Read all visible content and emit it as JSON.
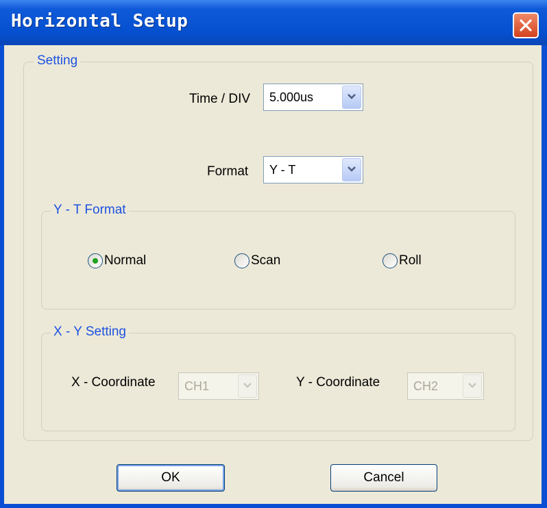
{
  "window": {
    "title": "Horizontal Setup"
  },
  "setting_group": {
    "legend": "Setting",
    "time_div_label": "Time / DIV",
    "time_div_value": "5.000us",
    "format_label": "Format",
    "format_value": "Y - T"
  },
  "yt_group": {
    "legend": "Y - T Format",
    "options": [
      {
        "label": "Normal",
        "selected": true
      },
      {
        "label": "Scan",
        "selected": false
      },
      {
        "label": "Roll",
        "selected": false
      }
    ]
  },
  "xy_group": {
    "legend": "X - Y Setting",
    "x_label": "X - Coordinate",
    "x_value": "CH1",
    "y_label": "Y - Coordinate",
    "y_value": "CH2",
    "enabled": false
  },
  "buttons": {
    "ok_label": "OK",
    "cancel_label": "Cancel"
  },
  "icons": {
    "close": "close-icon",
    "dropdown": "chevron-down-icon"
  },
  "colors": {
    "titlebar": "#0550d0",
    "client_bg": "#ece9d8",
    "legend_text": "#1c52e0",
    "close_button": "#d3411c",
    "radio_selected": "#21a121"
  }
}
